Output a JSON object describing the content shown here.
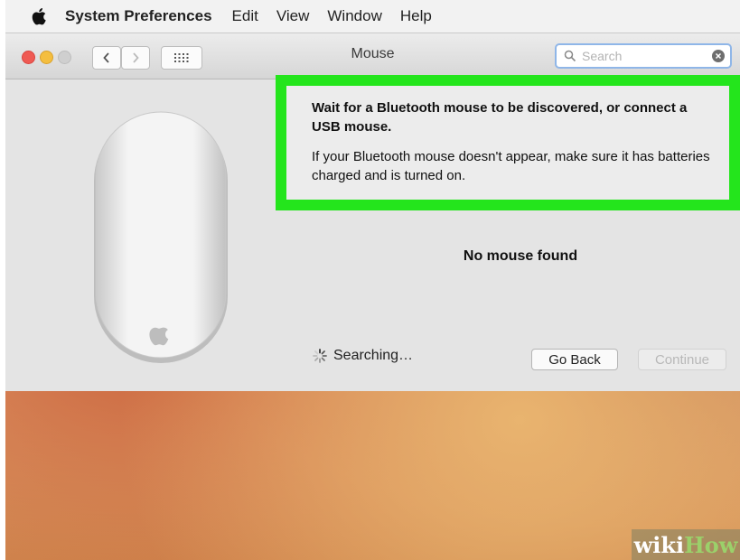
{
  "menubar": {
    "app_name": "System Preferences",
    "items": [
      "Edit",
      "View",
      "Window",
      "Help"
    ]
  },
  "window": {
    "title": "Mouse",
    "search": {
      "placeholder": "Search",
      "value": ""
    }
  },
  "callout": {
    "heading": "Wait for a Bluetooth mouse to be discovered, or connect a USB mouse.",
    "body": "If your Bluetooth mouse doesn't appear, make sure it has batteries charged and is turned on.",
    "highlight_color": "#24e51c"
  },
  "status": {
    "no_mouse": "No mouse found",
    "searching": "Searching…"
  },
  "buttons": {
    "go_back": "Go Back",
    "continue": "Continue"
  },
  "watermark": {
    "part1": "wiki",
    "part2": "How"
  },
  "icons": {
    "apple": "apple-logo",
    "back": "chevron-left-icon",
    "forward": "chevron-right-icon",
    "grid": "grid-icon",
    "search": "search-icon",
    "clear": "clear-icon",
    "spinner": "spinner-icon"
  }
}
